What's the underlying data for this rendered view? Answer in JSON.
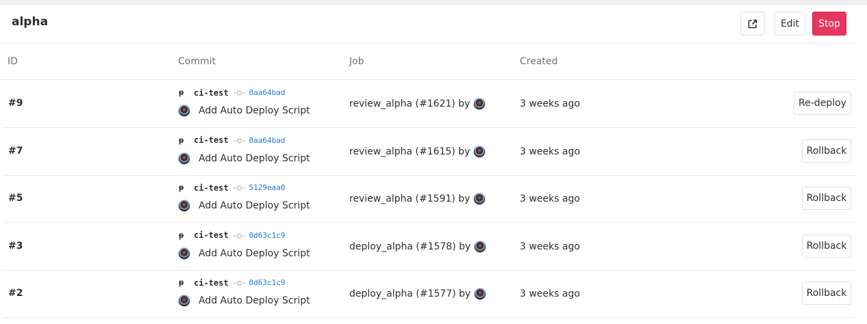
{
  "environment": {
    "name": "alpha",
    "actions": {
      "external_icon": "external-link-icon",
      "edit_label": "Edit",
      "stop_label": "Stop",
      "stop_color": "#e5375d"
    }
  },
  "table": {
    "headers": [
      "ID",
      "Commit",
      "Job",
      "Created"
    ],
    "rows": [
      {
        "id": "#9",
        "branch": "ci-test",
        "sha": "0aa64bad",
        "message": "Add Auto Deploy Script",
        "job": "review_alpha (#1621) by",
        "created": "3 weeks ago",
        "action": "Re-deploy"
      },
      {
        "id": "#7",
        "branch": "ci-test",
        "sha": "0aa64bad",
        "message": "Add Auto Deploy Script",
        "job": "review_alpha (#1615) by",
        "created": "3 weeks ago",
        "action": "Rollback"
      },
      {
        "id": "#5",
        "branch": "ci-test",
        "sha": "5129eaa0",
        "message": "Add Auto Deploy Script",
        "job": "review_alpha (#1591) by",
        "created": "3 weeks ago",
        "action": "Rollback"
      },
      {
        "id": "#3",
        "branch": "ci-test",
        "sha": "0d63c1c9",
        "message": "Add Auto Deploy Script",
        "job": "deploy_alpha (#1578) by",
        "created": "3 weeks ago",
        "action": "Rollback"
      },
      {
        "id": "#2",
        "branch": "ci-test",
        "sha": "0d63c1c9",
        "message": "Add Auto Deploy Script",
        "job": "deploy_alpha (#1577) by",
        "created": "3 weeks ago",
        "action": "Rollback"
      }
    ]
  },
  "icons": {
    "branch": "branch-icon",
    "commit": "commit-icon",
    "avatar": "user-avatar"
  },
  "colors": {
    "sha_link": "#1f78d1"
  }
}
